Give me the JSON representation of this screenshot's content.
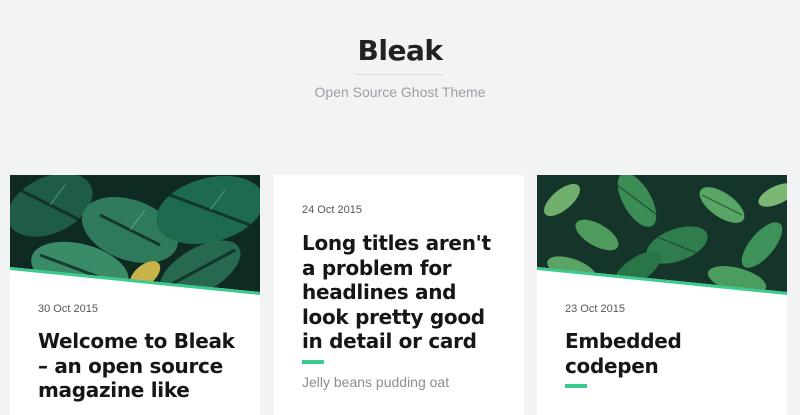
{
  "site": {
    "title": "Bleak",
    "description": "Open Source Ghost Theme"
  },
  "colors": {
    "background": "#f2f3f5",
    "accent": "#3ccb8e",
    "leaf_dark": "#0f2a22",
    "leaf_green": "#2e7a5a"
  },
  "posts": [
    {
      "date": "30 Oct 2015",
      "title": "Welcome to Bleak – an open source magazine like",
      "image": "tropical-leaves-image"
    },
    {
      "date": "24 Oct 2015",
      "title": "Long titles aren't a problem for headlines and look pretty good in detail or card",
      "excerpt": "Jelly beans pudding oat"
    },
    {
      "date": "23 Oct 2015",
      "title": "Embedded codepen",
      "image": "green-leaves-image"
    }
  ]
}
